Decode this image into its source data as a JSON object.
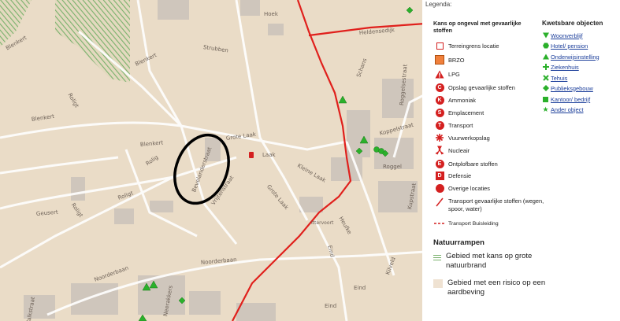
{
  "map": {
    "labels": [
      {
        "text": "Hoek"
      },
      {
        "text": "Strubben"
      },
      {
        "text": "Blenkert"
      },
      {
        "text": "Blenkert"
      },
      {
        "text": "Blenkert"
      },
      {
        "text": "Blenkert"
      },
      {
        "text": "Roligt"
      },
      {
        "text": "Roligt"
      },
      {
        "text": "Roligt"
      },
      {
        "text": "Rolig"
      },
      {
        "text": "Geusert"
      },
      {
        "text": "Grote Laak"
      },
      {
        "text": "Laak"
      },
      {
        "text": "Kleine Laak"
      },
      {
        "text": "Grote Laak"
      },
      {
        "text": "Bevelanderstraat"
      },
      {
        "text": "Vrijtenstraat"
      },
      {
        "text": "Noorderbaan"
      },
      {
        "text": "Noorderbaan"
      },
      {
        "text": "Valkstraat"
      },
      {
        "text": "Heldensedijk"
      },
      {
        "text": "Schans"
      },
      {
        "text": "Roggelsestraat"
      },
      {
        "text": "Koppelstraat"
      },
      {
        "text": "Roggel"
      },
      {
        "text": "Heufke"
      },
      {
        "text": "Kupstraat"
      },
      {
        "text": "Eind"
      },
      {
        "text": "Eind"
      },
      {
        "text": "Eind"
      },
      {
        "text": "Kilveld"
      },
      {
        "text": "Ittervoort"
      },
      {
        "text": "Neerakkers"
      }
    ]
  },
  "legend": {
    "title": "Legenda:",
    "risk_heading": "Kans op ongeval met gevaarlijke stoffen",
    "risk_items": [
      {
        "icon": "square-outline-icon",
        "label": "Terreingrens locatie"
      },
      {
        "icon": "orange-square-icon",
        "label": "BRZO"
      },
      {
        "icon": "warning-triangle-icon",
        "label": "LPG"
      },
      {
        "icon": "circle-c-icon",
        "label": "Opslag gevaarlijke stoffen"
      },
      {
        "icon": "circle-k-icon",
        "label": "Ammoniak"
      },
      {
        "icon": "circle-s-icon",
        "label": "Emplacement"
      },
      {
        "icon": "circle-t-icon",
        "label": "Transport"
      },
      {
        "icon": "firework-icon",
        "label": "Vuurwerkopslag"
      },
      {
        "icon": "nuclear-icon",
        "label": "Nucleair"
      },
      {
        "icon": "circle-e-icon",
        "label": "Ontplofbare stoffen"
      },
      {
        "icon": "square-d-icon",
        "label": "Defensie"
      },
      {
        "icon": "red-dot-icon",
        "label": "Overige locaties"
      },
      {
        "icon": "red-line-icon",
        "label": "Transport gevaarlijke stoffen (wegen, spoor, water)"
      },
      {
        "icon": "dashed-line-icon",
        "label": "Transport Buisleiding"
      }
    ],
    "vulnerable_heading": "Kwetsbare objecten",
    "vulnerable_items": [
      {
        "icon": "down-triangle-icon",
        "label": "Woonverblijf"
      },
      {
        "icon": "hexagon-icon",
        "label": "Hotel/ pension"
      },
      {
        "icon": "triangle-icon",
        "label": "Onderwijsinstelling"
      },
      {
        "icon": "cross-icon",
        "label": "Ziekenhuis"
      },
      {
        "icon": "x-icon",
        "label": "Tehuis"
      },
      {
        "icon": "diamond-icon",
        "label": "Publieksgebouw"
      },
      {
        "icon": "square-icon",
        "label": "Kantoor/ bedrijf"
      },
      {
        "icon": "star-icon",
        "label": "Ander object"
      }
    ],
    "nature_heading": "Natuurrampen",
    "nature_items": [
      {
        "icon": "hatch-icon",
        "label": "Gebied met kans op grote natuurbrand"
      },
      {
        "icon": "beige-square-icon",
        "label": "Gebied met een risico op een aardbeving"
      }
    ]
  },
  "colors": {
    "map_bg": "#eadcc7",
    "road_red": "#e0201c",
    "object_green": "#2bb02b",
    "highlight_ellipse": "#000000"
  }
}
